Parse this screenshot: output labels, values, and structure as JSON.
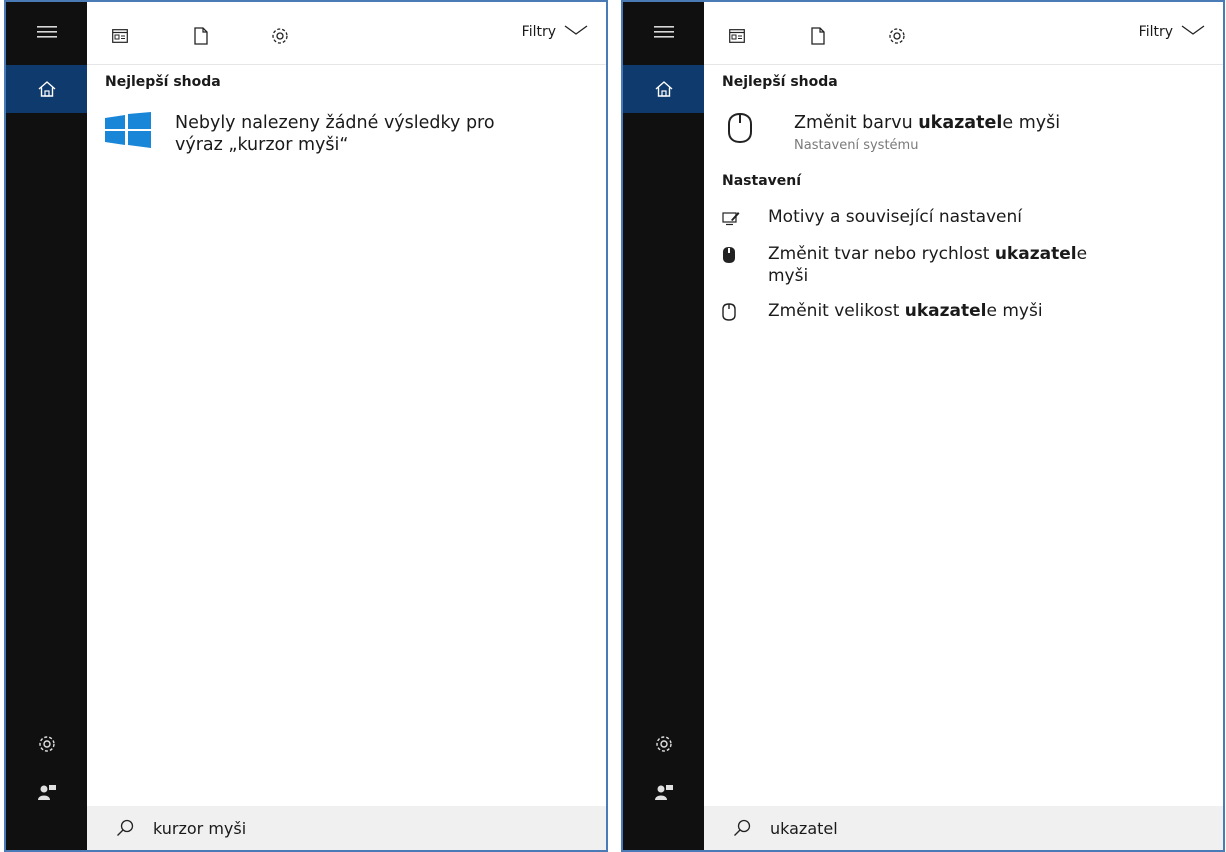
{
  "left": {
    "filters_label": "Filtry",
    "best_match_title": "Nejlepší shoda",
    "no_result_line1": "Nebyly nalezeny žádné výsledky pro",
    "no_result_line2": "výraz „kurzor myši“",
    "search_query": "kurzor myši"
  },
  "right": {
    "filters_label": "Filtry",
    "best_match_title": "Nejlepší shoda",
    "best_match": {
      "before": "Změnit barvu ",
      "bold": "ukazatel",
      "after": "e myši",
      "subtitle": "Nastavení systému",
      "icon": "mouse-icon"
    },
    "settings_title": "Nastavení",
    "settings_items": [
      {
        "before": "Motivy a související nastavení",
        "bold": "",
        "after": "",
        "icon": "theme-icon"
      },
      {
        "before": "Změnit tvar nebo rychlost ",
        "bold": "ukazatel",
        "after": "e",
        "line2": "myši",
        "icon": "mouse-filled-icon"
      },
      {
        "before": "Změnit velikost ",
        "bold": "ukazatel",
        "after": "e myši",
        "icon": "mouse-icon"
      }
    ],
    "search_query": "ukazatel"
  },
  "colors": {
    "rail": "#101010",
    "rail_selected": "#0f3a6e",
    "windows_blue": "#1a86d8",
    "panel_border": "#4a7bb7",
    "search_bg": "#f0f0f0"
  },
  "icons": {
    "menu": "hamburger-icon",
    "home": "home-icon",
    "apps": "apps-icon",
    "documents": "document-icon",
    "settings": "gear-icon",
    "feedback": "feedback-icon",
    "search": "search-icon",
    "filter_chevron": "chevron-down-icon"
  }
}
